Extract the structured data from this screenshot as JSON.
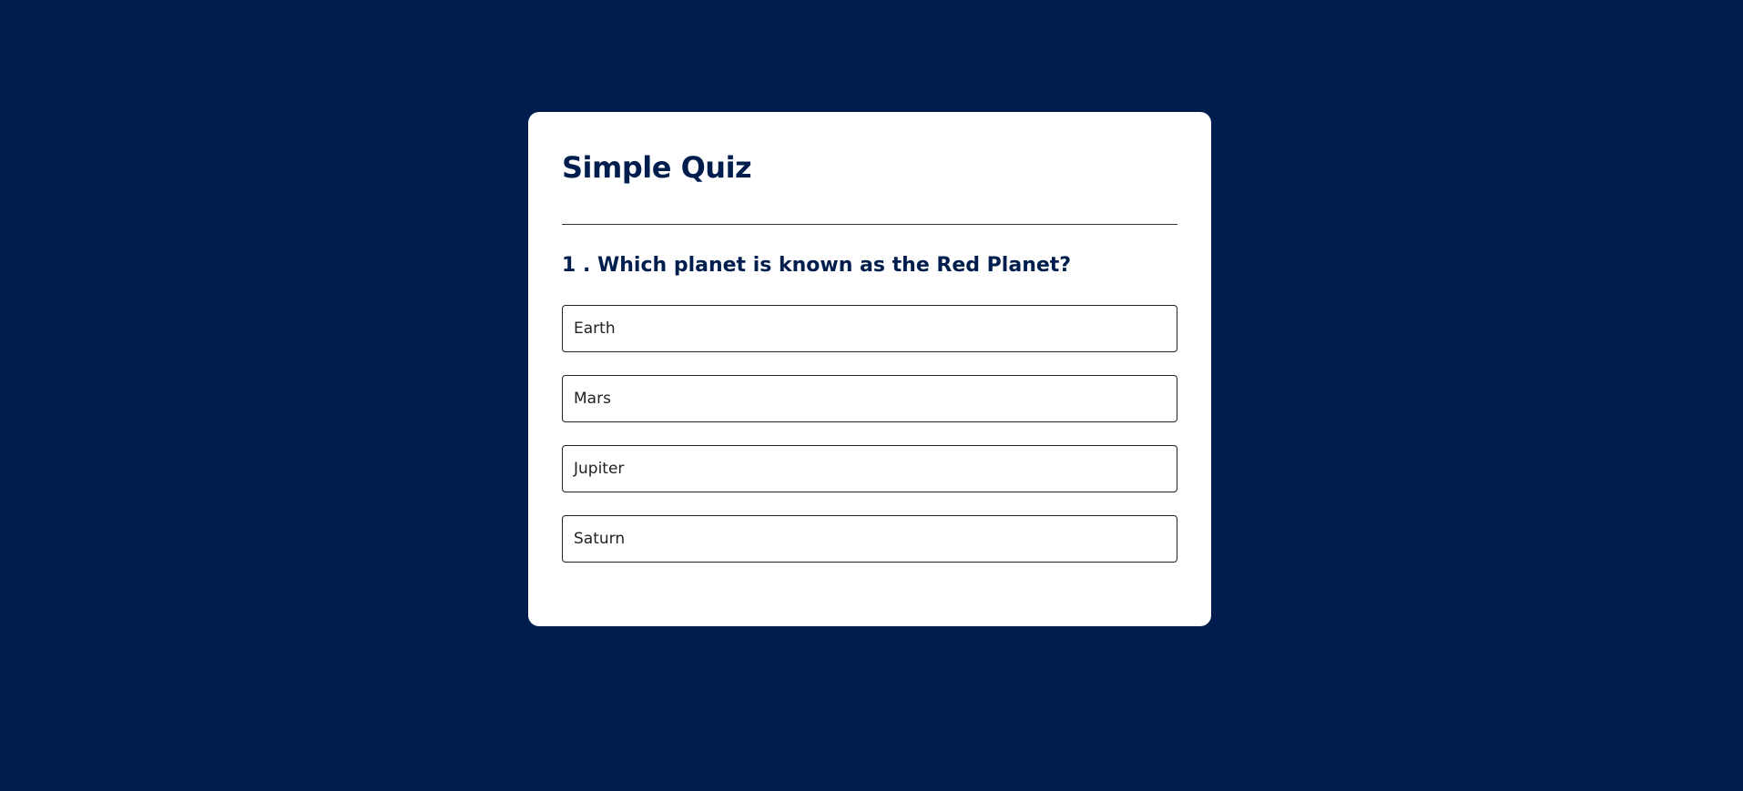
{
  "background_color": "#001e4d",
  "card": {
    "title": "Simple Quiz",
    "question": "1 . Which planet is known as the Red Planet?",
    "answers": [
      {
        "label": "Earth"
      },
      {
        "label": "Mars"
      },
      {
        "label": "Jupiter"
      },
      {
        "label": "Saturn"
      }
    ]
  },
  "colors": {
    "accent": "#001e4d",
    "card_bg": "#ffffff",
    "answer_border": "#222222"
  }
}
